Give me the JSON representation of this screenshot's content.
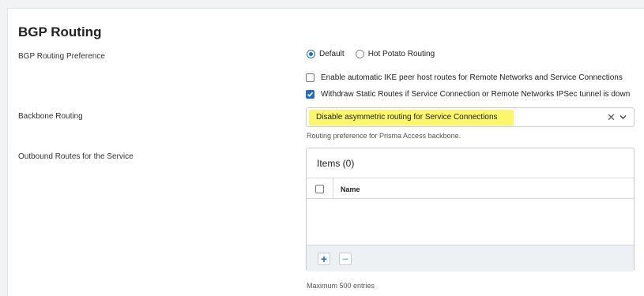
{
  "section": {
    "title": "BGP Routing"
  },
  "bgp_pref": {
    "label": "BGP Routing Preference",
    "options": [
      {
        "label": "Default",
        "selected": true
      },
      {
        "label": "Hot Potato Routing",
        "selected": false
      }
    ]
  },
  "checks": {
    "ike": {
      "label": "Enable automatic IKE peer host routes for Remote Networks and Service Connections",
      "checked": false
    },
    "withdraw": {
      "label": "Withdraw Static Routes if Service Connection or Remote Networks IPSec tunnel is down",
      "checked": true
    }
  },
  "backbone": {
    "label": "Backbone Routing",
    "value": "Disable asymmetric routing for Service Connections",
    "help": "Routing preference for Prisma Access backbone.",
    "clear_icon": "close-icon",
    "caret_icon": "chevron-down-icon",
    "highlight_color": "#fbf66a"
  },
  "outbound": {
    "label": "Outbound Routes for the Service",
    "items_title": "Items (0)",
    "column_name": "Name",
    "add_label": "+",
    "remove_label": "−",
    "max_text": "Maximum 500 entries"
  },
  "colors": {
    "accent": "#1a73c8"
  }
}
